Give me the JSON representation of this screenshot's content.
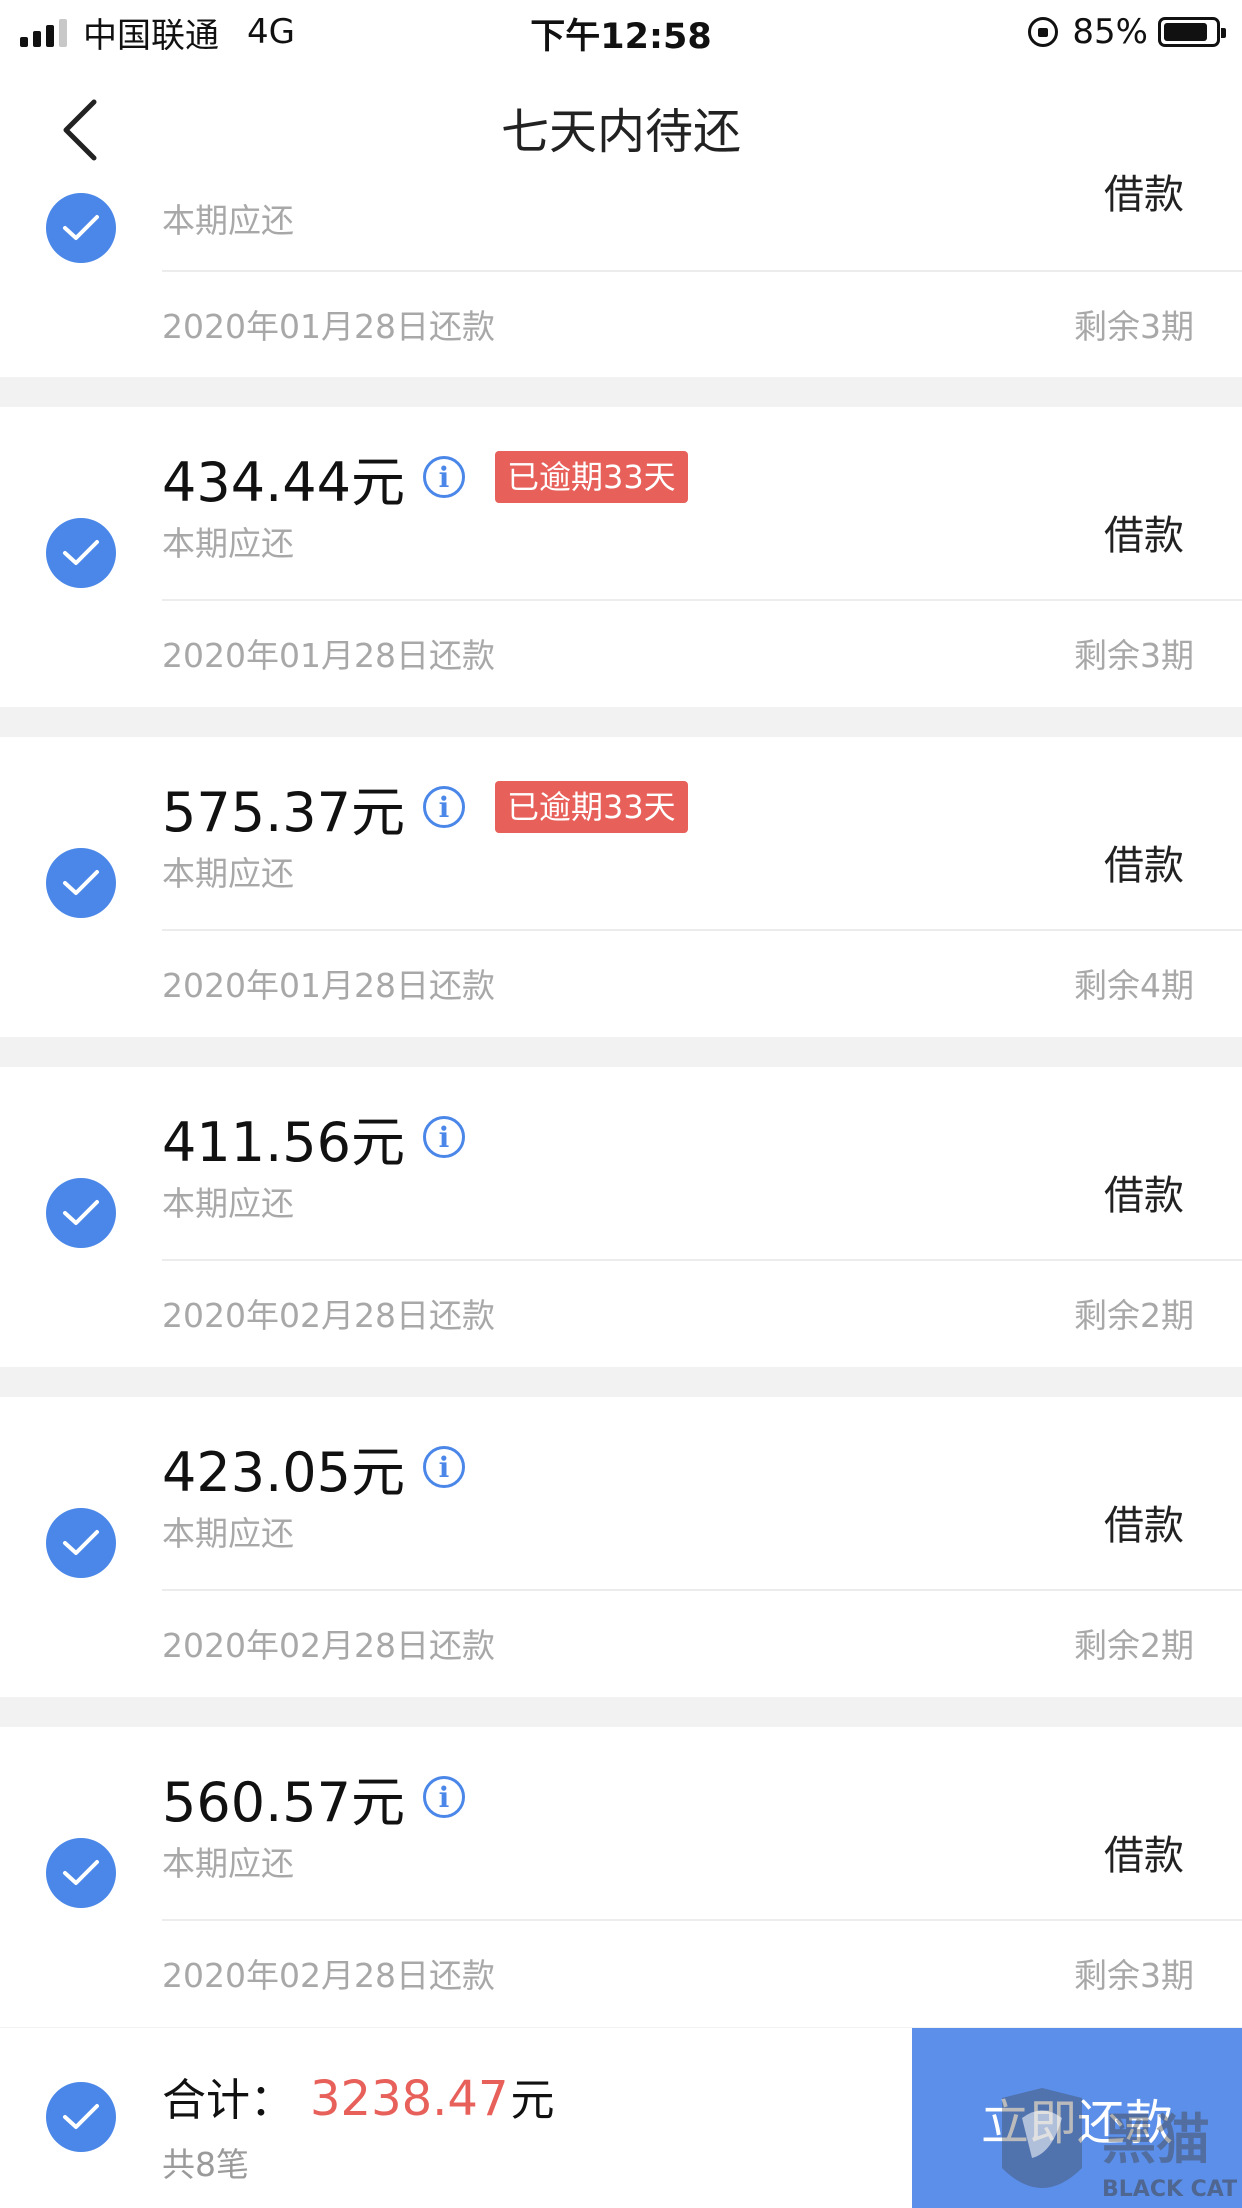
{
  "status_bar": {
    "carrier": "中国联通",
    "network": "4G",
    "time": "下午12:58",
    "battery": "85%",
    "battery_level": 0.85
  },
  "nav": {
    "title": "七天内待还"
  },
  "items": [
    {
      "amount": "",
      "overdue": "",
      "sub": "本期应还",
      "type": "借款",
      "date": "2020年01月28日还款",
      "remaining": "剩余3期",
      "checked": true
    },
    {
      "amount": "434.44元",
      "overdue": "已逾期33天",
      "sub": "本期应还",
      "type": "借款",
      "date": "2020年01月28日还款",
      "remaining": "剩余3期",
      "checked": true
    },
    {
      "amount": "575.37元",
      "overdue": "已逾期33天",
      "sub": "本期应还",
      "type": "借款",
      "date": "2020年01月28日还款",
      "remaining": "剩余4期",
      "checked": true
    },
    {
      "amount": "411.56元",
      "overdue": "",
      "sub": "本期应还",
      "type": "借款",
      "date": "2020年02月28日还款",
      "remaining": "剩余2期",
      "checked": true
    },
    {
      "amount": "423.05元",
      "overdue": "",
      "sub": "本期应还",
      "type": "借款",
      "date": "2020年02月28日还款",
      "remaining": "剩余2期",
      "checked": true
    },
    {
      "amount": "560.57元",
      "overdue": "",
      "sub": "本期应还",
      "type": "借款",
      "date": "2020年02月28日还款",
      "remaining": "剩余3期",
      "checked": true
    }
  ],
  "footer": {
    "total_label": "合计：",
    "total_value": "3238.47",
    "total_unit": "元",
    "count": "共8笔",
    "pay_button": "立即还款"
  },
  "watermark": {
    "text_cn": "黑猫",
    "text_en": "BLACK CAT"
  },
  "colors": {
    "accent": "#4a87e8",
    "overdue": "#e8605a",
    "pay_button": "#5b8fea"
  }
}
